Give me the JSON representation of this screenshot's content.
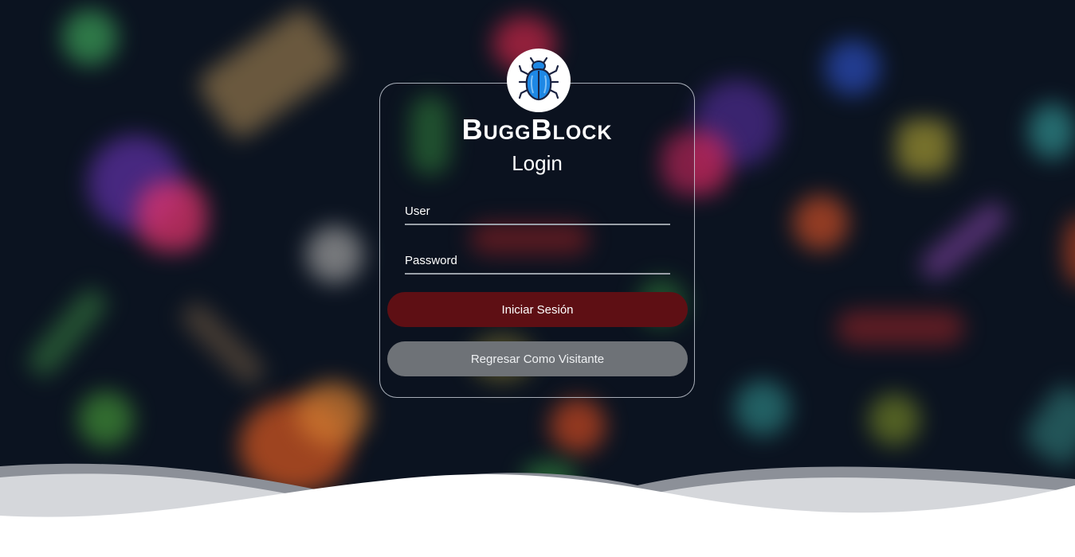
{
  "brand": {
    "name": "BuggBlock",
    "logo_icon": "beetle-icon",
    "accent": "#1e88e5"
  },
  "login": {
    "title": "Login",
    "user_label": "User",
    "password_label": "Password",
    "submit_label": "Iniciar Sesión",
    "guest_label": "Regresar Como Visitante"
  },
  "colors": {
    "background": "#0b1320",
    "submit_button": "#5e0f14",
    "guest_button": "#6e7277",
    "wave": "#ffffff"
  }
}
